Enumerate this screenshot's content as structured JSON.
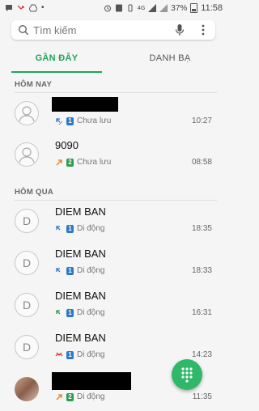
{
  "status_bar": {
    "battery_percent": "37%",
    "time": "11:58",
    "network": "4G"
  },
  "search": {
    "placeholder": "Tìm kiếm"
  },
  "tabs": [
    {
      "label": "GẦN ĐÂY",
      "active": true
    },
    {
      "label": "DANH BẠ",
      "active": false
    }
  ],
  "sections": [
    {
      "title": "HÔM NAY"
    },
    {
      "title": "HÔM QUA"
    }
  ],
  "calls": [
    {
      "name": "",
      "redacted": true,
      "avatar": "person-icon",
      "sim": "1",
      "label": "Chưa lưu",
      "time": "10:27",
      "call_type": "incoming"
    },
    {
      "name": "9090",
      "avatar": "person-icon",
      "sim": "2",
      "label": "Chưa lưu",
      "time": "08:58",
      "call_type": "outgoing"
    },
    {
      "name": "DIEM BAN",
      "avatar_letter": "D",
      "sim": "1",
      "label": "Di động",
      "time": "18:35",
      "call_type": "incoming"
    },
    {
      "name": "DIEM BAN",
      "avatar_letter": "D",
      "sim": "1",
      "label": "Di động",
      "time": "18:33",
      "call_type": "incoming"
    },
    {
      "name": "DIEM BAN",
      "avatar_letter": "D",
      "sim": "1",
      "label": "Di động",
      "time": "16:31",
      "call_type": "incoming-green"
    },
    {
      "name": "DIEM BAN",
      "avatar_letter": "D",
      "sim": "1",
      "label": "Di động",
      "time": "14:23",
      "call_type": "missed"
    },
    {
      "name": "",
      "redacted": true,
      "avatar": "photo",
      "sim": "2",
      "label": "Di động",
      "time": "11:35",
      "call_type": "outgoing"
    }
  ],
  "colors": {
    "accent": "#21a35b",
    "fab": "#2fb86a",
    "sim1": "#2d79c7",
    "sim2": "#2e9a4d"
  }
}
